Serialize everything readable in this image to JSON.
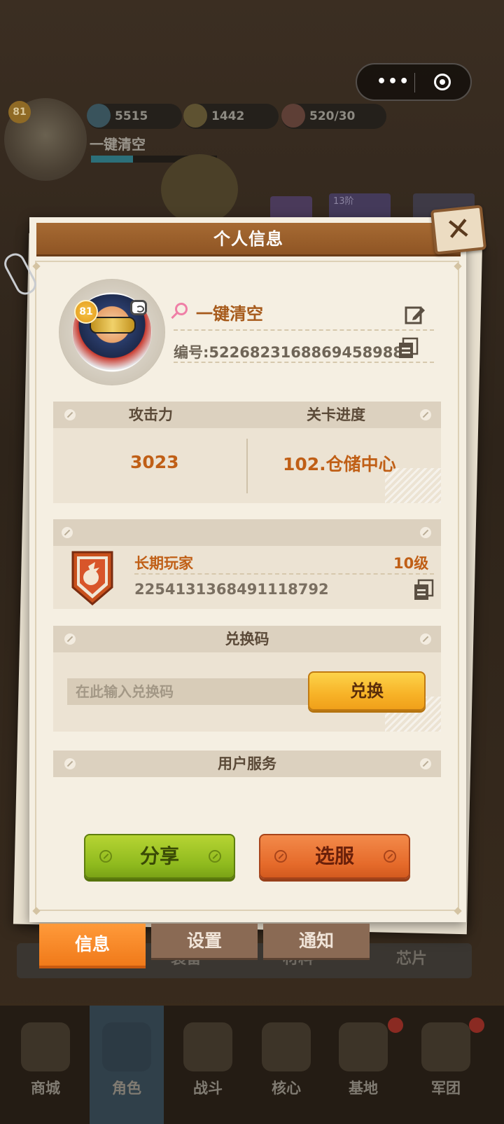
{
  "background": {
    "resources": [
      {
        "icon": "gem-icon",
        "value": "5515"
      },
      {
        "icon": "gold-coin-icon",
        "value": "1442"
      },
      {
        "icon": "drumstick-icon",
        "value": "520/30"
      }
    ],
    "player_level": "81",
    "player_name": "一键清空",
    "card_label": "13阶",
    "bottom_tabs": [
      "装备",
      "材料",
      "芯片"
    ],
    "nav": [
      "商城",
      "角色",
      "战斗",
      "核心",
      "基地",
      "军团"
    ]
  },
  "capsule": {
    "more": "•••"
  },
  "modal": {
    "title": "个人信息",
    "profile": {
      "level": "81",
      "nickname": "一键清空",
      "id_text": "编号:5226823168869458988"
    },
    "stats": {
      "attack_label": "攻击力",
      "progress_label": "关卡进度",
      "attack_value": "3023",
      "progress_value": "102.仓储中心"
    },
    "badge": {
      "name": "长期玩家",
      "level": "10级",
      "code": "2254131368491118792"
    },
    "redeem": {
      "header": "兑换码",
      "placeholder": "在此输入兑换码",
      "button": "兑换"
    },
    "service": {
      "header": "用户服务"
    },
    "buttons": {
      "share": "分享",
      "server": "选服"
    }
  },
  "tabs": {
    "info": "信息",
    "settings": "设置",
    "notice": "通知"
  },
  "colors": {
    "accent_orange": "#f07a1a",
    "title_brown": "#9a5e2b",
    "value_orange": "#c05f16"
  }
}
